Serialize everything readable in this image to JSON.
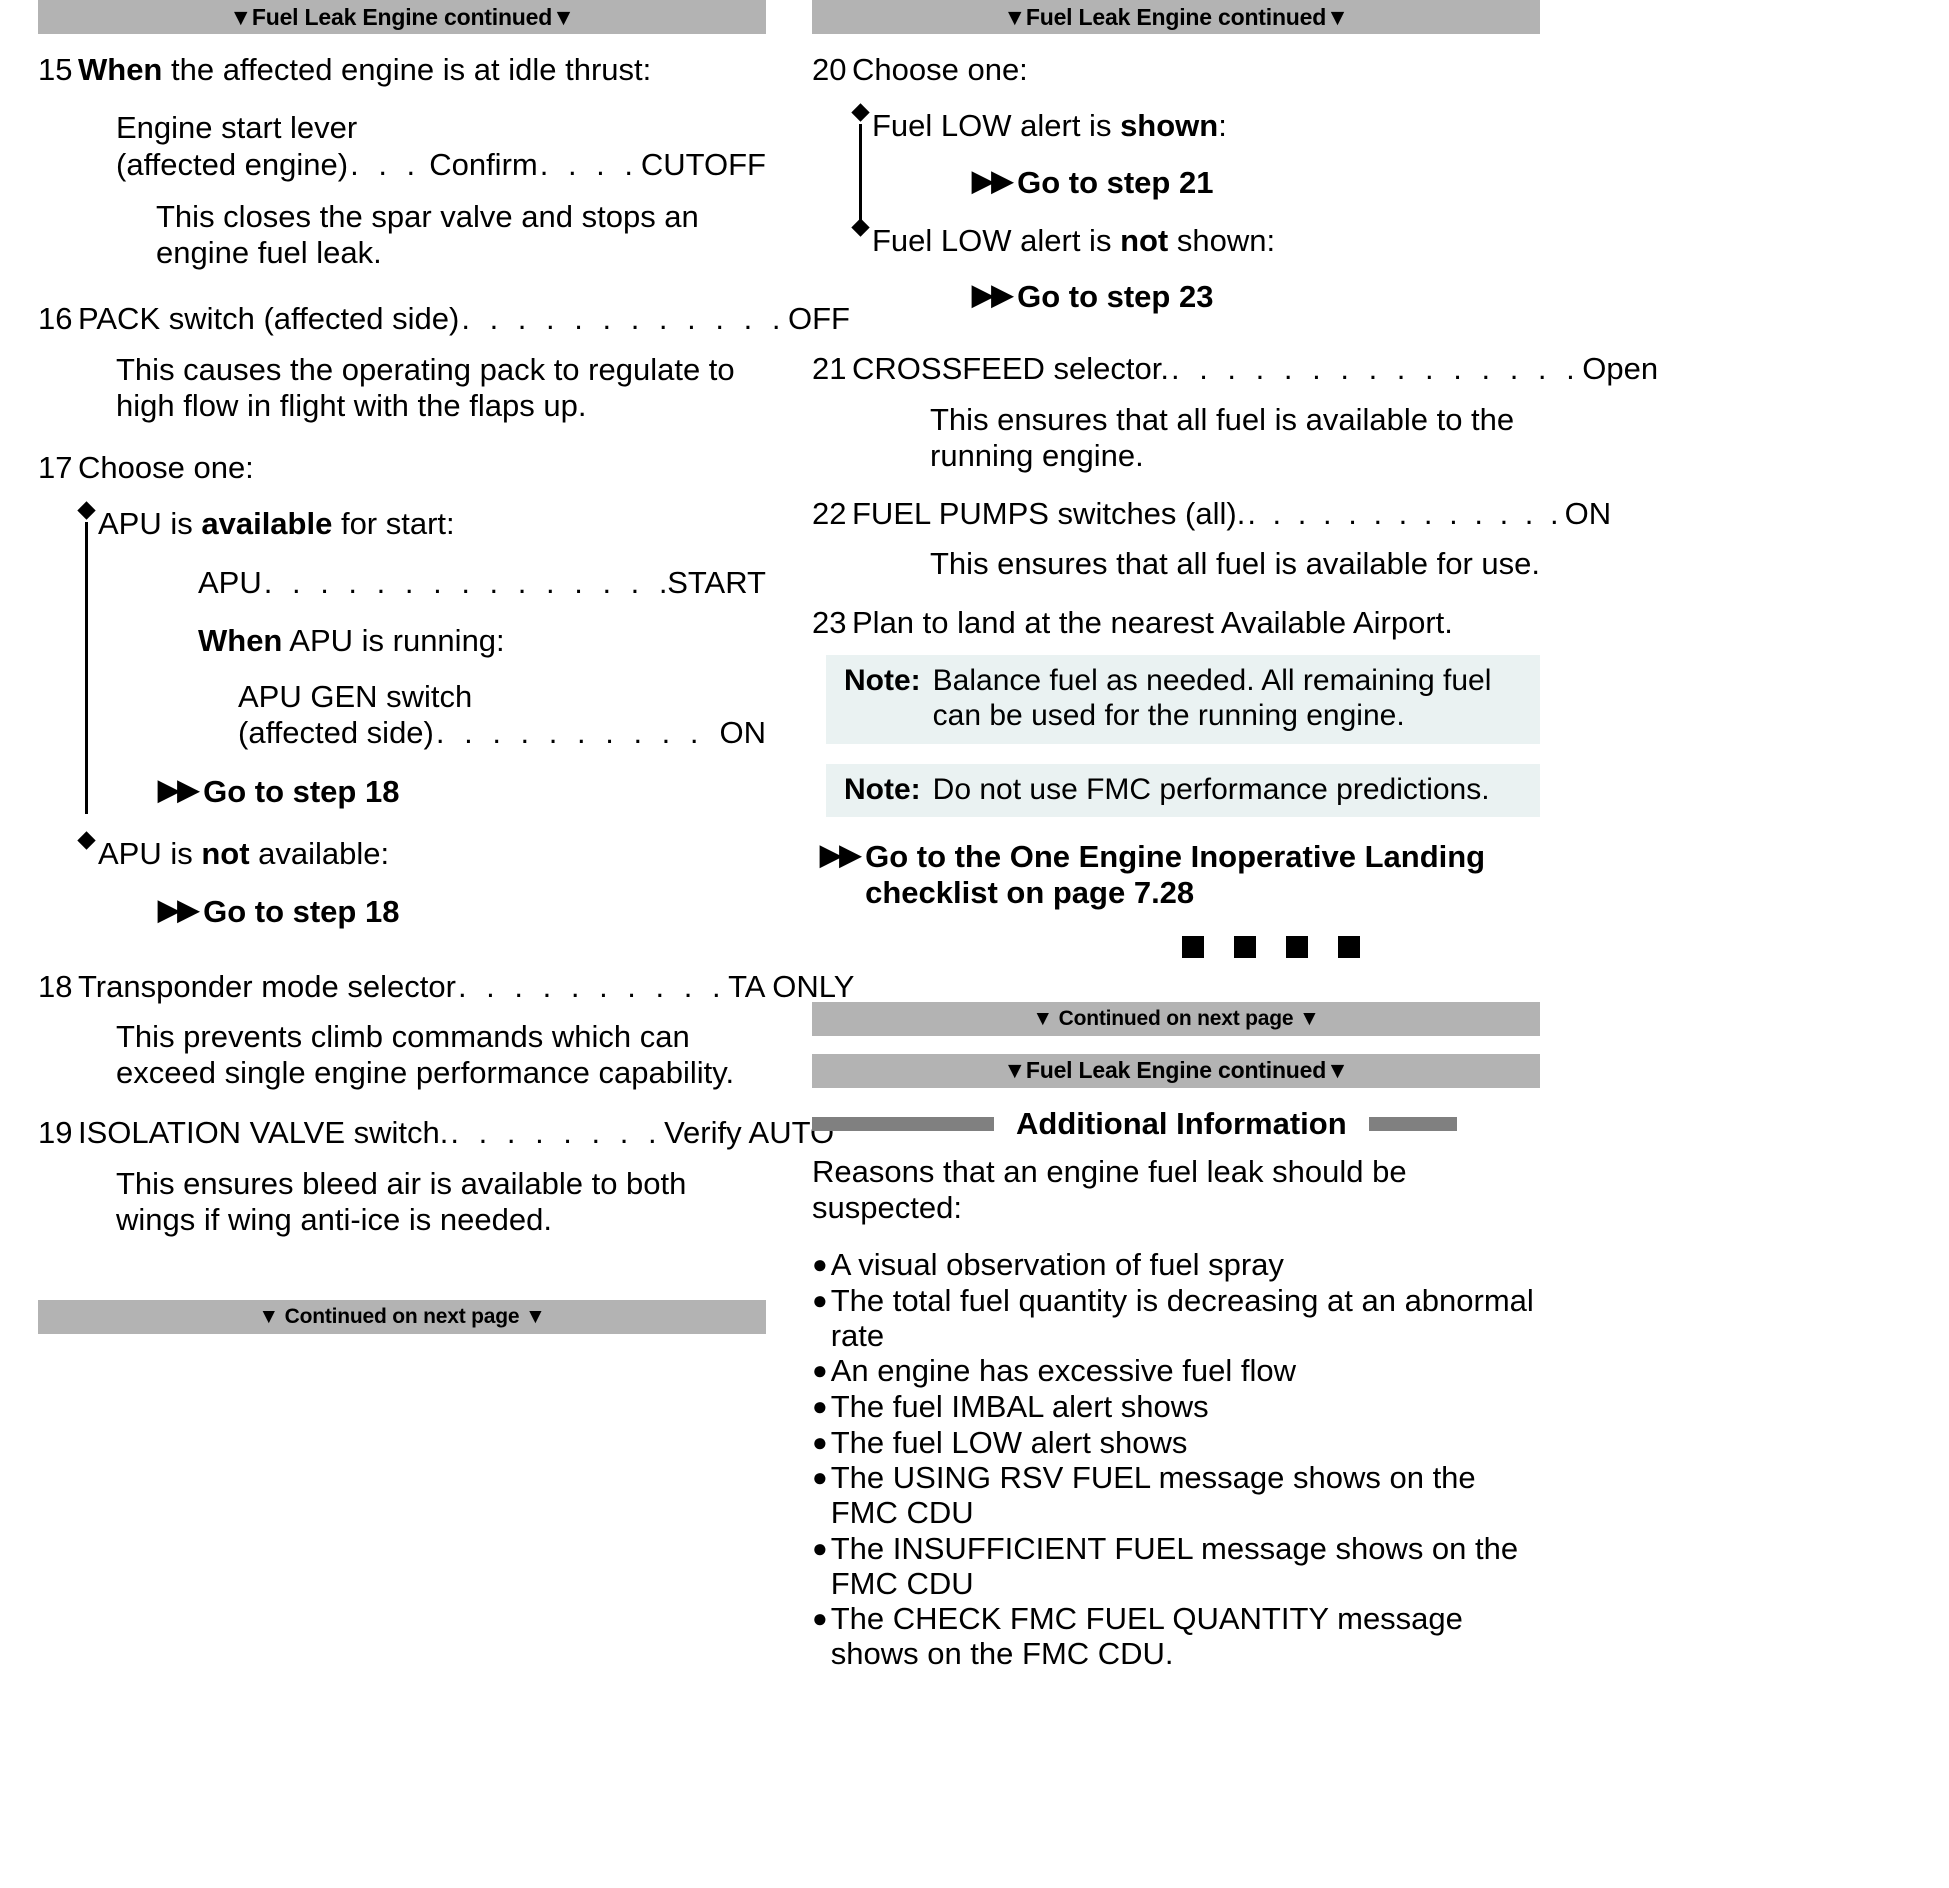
{
  "document": {
    "title": "Fuel Leak Engine continued",
    "bar_tri": "▼",
    "arrows": "▶▶",
    "bullet": "●",
    "diamond": "◆"
  },
  "left_column": {
    "header": "▼Fuel Leak Engine continued▼",
    "header_text": "Fuel Leak Engine continued",
    "steps": [
      {
        "num": "15",
        "title_bold": "When",
        "title_rest": " the affected engine is at idle thrust:",
        "item_label_line1": "Engine start lever",
        "item_label_line2": "(affected engine)",
        "dots1": ". . . .",
        "middle": "Confirm",
        "dots2": ". . . . .",
        "value": "CUTOFF",
        "explain": "This closes the spar valve and stops an engine fuel leak."
      },
      {
        "num": "16",
        "label": "PACK switch (affected side)",
        "dots": ". . . . . . . . . . . .",
        "value": "OFF",
        "explain": "This causes the operating pack to regulate to high flow in flight with the flaps up."
      },
      {
        "num": "17",
        "title": "Choose one:",
        "branches": [
          {
            "text_pre": "APU is ",
            "text_bold": "available",
            "text_post": " for start:",
            "sub_label": "APU",
            "sub_dots": ". . . . . . . . . . . . . . . . . . . . .",
            "sub_value": "START",
            "when_bold": "When",
            "when_rest": " APU is running:",
            "sub2_line1": "APU GEN switch",
            "sub2_line2": "(affected side)",
            "sub2_dots": ". . . . . . . . . . . .",
            "sub2_value": "ON",
            "goto": "Go to step 18"
          },
          {
            "text_pre": "APU is ",
            "text_bold": "not",
            "text_post": " available:",
            "goto": "Go to step 18"
          }
        ]
      },
      {
        "num": "18",
        "label": "Transponder mode selector",
        "dots": ". . . . . . . . . .",
        "value": "TA ONLY",
        "explain": "This prevents climb commands which can exceed single engine performance capability."
      },
      {
        "num": "19",
        "label": "ISOLATION VALVE switch.",
        "dots": ". . . . . . . .",
        "value": "Verify AUTO",
        "explain": "This ensures bleed air is available to both wings if wing anti-ice is needed."
      }
    ],
    "continued_bar": "▼ Continued on next page ▼",
    "continued_text": "Continued on next page"
  },
  "right_column": {
    "header": "▼Fuel Leak Engine continued▼",
    "header_text": "Fuel Leak Engine continued",
    "steps": [
      {
        "num": "20",
        "title": "Choose one:",
        "branches": [
          {
            "text_pre": "Fuel LOW alert is ",
            "text_bold": "shown",
            "text_post": ":",
            "goto": "Go to step 21"
          },
          {
            "text_pre": "Fuel LOW alert is ",
            "text_bold": "not",
            "text_post": " shown:",
            "goto": "Go to step 23"
          }
        ]
      },
      {
        "num": "21",
        "label": "CROSSFEED selector.",
        "dots": ". . . . . . . . . . . . . . .",
        "value": "Open",
        "explain": "This ensures that all fuel is available to the running engine."
      },
      {
        "num": "22",
        "label": "FUEL PUMPS switches (all).",
        "dots": ". . . . . . . . . . . . .",
        "value": "ON",
        "explain": "This ensures that all fuel is available for use."
      },
      {
        "num": "23",
        "title": "Plan to land at the nearest Available Airport."
      }
    ],
    "notes": [
      {
        "label": "Note:",
        "text": "Balance fuel as needed. All remaining fuel can be used for the running engine."
      },
      {
        "label": "Note:",
        "text": "Do not use FMC performance predictions."
      }
    ],
    "final_goto_line1": "Go to the One Engine Inoperative Landing",
    "final_goto_line2": "checklist on page 7.28",
    "continued_bar": "▼ Continued on next page ▼",
    "continued_text": "Continued on next page",
    "header2": "▼Fuel Leak Engine continued▼",
    "header2_text": "Fuel Leak Engine continued",
    "additional_info": {
      "title": "Additional Information",
      "intro": "Reasons that an engine fuel leak should be suspected:",
      "bullets": [
        "A visual observation of fuel spray",
        "The total fuel quantity is decreasing at an abnormal rate",
        "An engine has excessive fuel flow",
        "The fuel IMBAL alert shows",
        "The fuel LOW alert shows",
        "The USING RSV FUEL message shows on the FMC CDU",
        "The INSUFFICIENT FUEL message shows on the FMC CDU",
        "The CHECK FMC FUEL QUANTITY message shows on the FMC CDU."
      ]
    }
  },
  "colors": {
    "bar_gray": "#b3b3b3",
    "rule_gray": "#808080",
    "note_bg": "#eaf2f2"
  }
}
